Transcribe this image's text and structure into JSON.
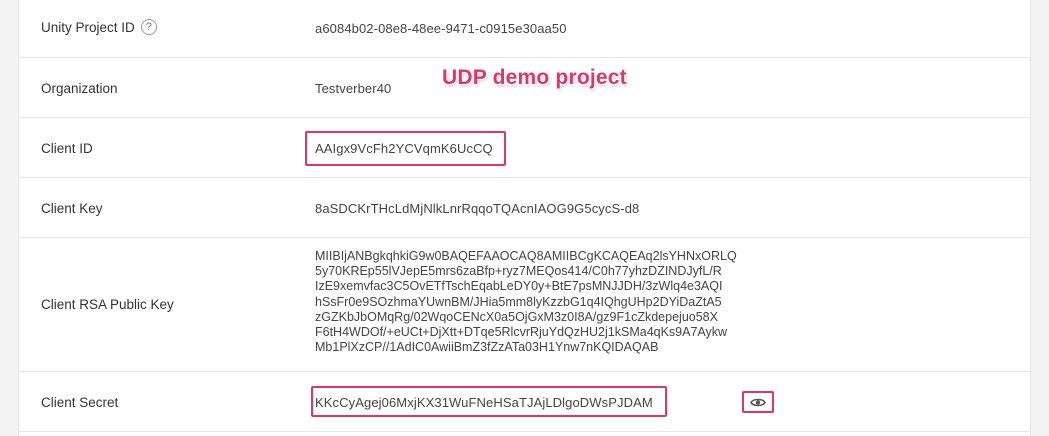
{
  "rows": [
    {
      "label": "Unity Project ID",
      "value": "a6084b02-08e8-48ee-9471-c0915e30aa50",
      "help": "?"
    },
    {
      "label": "Organization",
      "value": "Testverber40"
    },
    {
      "label": "Client ID",
      "value": "AAIgx9VcFh2YCVqmK6UcCQ"
    },
    {
      "label": "Client Key",
      "value": "8aSDCKrTHcLdMjNlkLnrRqqoTQAcnIAOG9G5cycS-d8"
    },
    {
      "label": "Client RSA Public Key",
      "value_lines": [
        "MIIBIjANBgkqhkiG9w0BAQEFAAOCAQ8AMIIBCgKCAQEAq2lsYHNxORLQ",
        "5y70KREp55lVJepE5mrs6zaBfp+ryz7MEQos414/C0h77yhzDZINDJyfL/R",
        "IzE9xemvfac3C5OvETfTschEqabLeDY0y+BtE7psMNJJDH/3zWlq4e3AQI",
        "hSsFr0e9SOzhmaYUwnBM/JHia5mm8lyKzzbG1q4IQhgUHp2DYiDaZtA5",
        "zGZKbJbOMqRg/02WqoCENcX0a5OjGxM3z0I8A/gz9F1cZkdepejuo58X",
        "F6tH4WDOf/+eUCt+DjXtt+DTqe5RlcvrRjuYdQzHU2j1kSMa4qKs9A7Aykw",
        "Mb1PlXzCP//1AdIC0AwiiBmZ3fZzATa03H1Ynw7nKQIDAQAB"
      ]
    },
    {
      "label": "Client Secret",
      "value": "KKcCyAgej06MxjKX31WuFNeHSaTJAjLDlgoDWsPJDAM",
      "reveal_icon": "eye-icon"
    }
  ],
  "annotation": "UDP demo project",
  "colors": {
    "highlight": "#e0356b",
    "background": "#f3f3f3"
  }
}
